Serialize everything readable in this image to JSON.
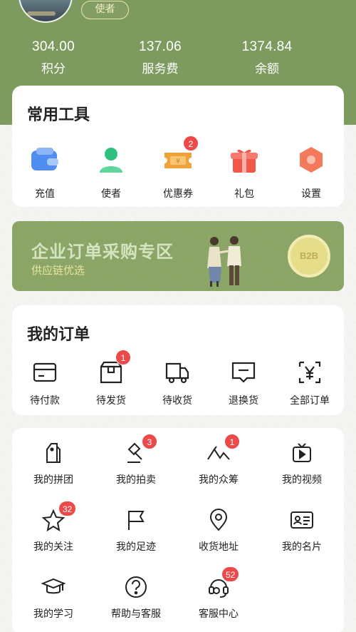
{
  "profile": {
    "role_badge": "使者"
  },
  "stats": [
    {
      "value": "304.00",
      "label": "积分"
    },
    {
      "value": "137.06",
      "label": "服务费"
    },
    {
      "value": "1374.84",
      "label": "余额"
    }
  ],
  "tools": {
    "title": "常用工具",
    "items": [
      {
        "label": "充值",
        "icon": "wallet-icon",
        "color": "#4f8df0"
      },
      {
        "label": "使者",
        "icon": "user-icon",
        "color": "#2ec27e"
      },
      {
        "label": "优惠券",
        "icon": "coupon-icon",
        "color": "#f0a23a",
        "badge": "2"
      },
      {
        "label": "礼包",
        "icon": "gift-icon",
        "color": "#f0574a"
      },
      {
        "label": "设置",
        "icon": "settings-icon",
        "color": "#f37a5a"
      }
    ]
  },
  "banner": {
    "title": "企业订单采购专区",
    "subtitle": "供应链优选",
    "coin_text": "B2B"
  },
  "orders": {
    "title": "我的订单",
    "items": [
      {
        "label": "待付款",
        "icon": "card-icon"
      },
      {
        "label": "待发货",
        "icon": "box-icon",
        "badge": "1"
      },
      {
        "label": "待收货",
        "icon": "truck-icon"
      },
      {
        "label": "退换货",
        "icon": "return-icon"
      },
      {
        "label": "全部订单",
        "icon": "yen-receipt-icon"
      }
    ]
  },
  "services": {
    "items": [
      {
        "label": "我的拼团",
        "icon": "group-tag-icon"
      },
      {
        "label": "我的拍卖",
        "icon": "gavel-icon",
        "badge": "3"
      },
      {
        "label": "我的众筹",
        "icon": "mountain-icon",
        "badge": "1"
      },
      {
        "label": "我的视频",
        "icon": "tv-icon"
      },
      {
        "label": "我的关注",
        "icon": "star-icon",
        "badge": "32"
      },
      {
        "label": "我的足迹",
        "icon": "flag-icon"
      },
      {
        "label": "收货地址",
        "icon": "location-icon"
      },
      {
        "label": "我的名片",
        "icon": "id-card-icon"
      },
      {
        "label": "我的学习",
        "icon": "graduation-cap-icon"
      },
      {
        "label": "帮助与客服",
        "icon": "help-icon"
      },
      {
        "label": "客服中心",
        "icon": "headset-icon",
        "badge": "52"
      }
    ]
  }
}
